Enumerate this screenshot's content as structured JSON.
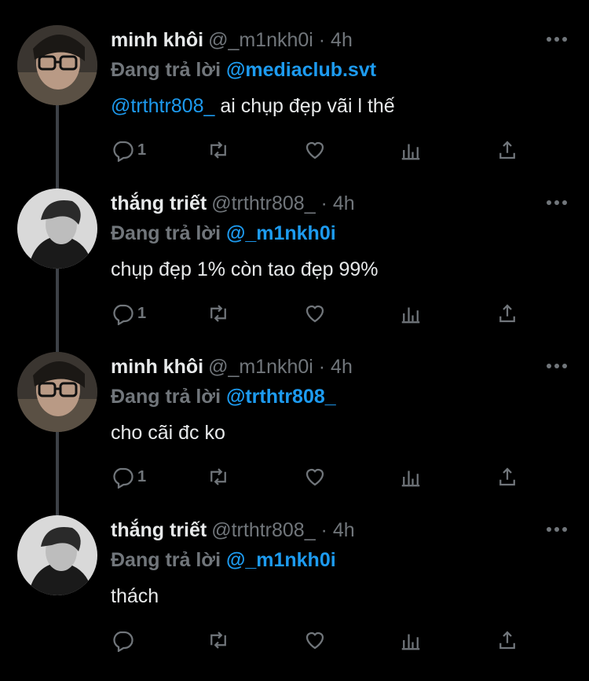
{
  "tweets": [
    {
      "name": "minh khôi",
      "handle": "@_m1nkh0i · 4h",
      "reply_prefix": "Đang trả lời",
      "reply_to": "@mediaclub.svt",
      "mention": "@trthtr808_",
      "text": " ai chụp đẹp vãi l thế",
      "reply_count": "1"
    },
    {
      "name": "thắng triết",
      "handle": "@trthtr808_ · 4h",
      "reply_prefix": "Đang trả lời",
      "reply_to": "@_m1nkh0i",
      "mention": "",
      "text": "chụp đẹp 1% còn tao đẹp 99%",
      "reply_count": "1"
    },
    {
      "name": "minh khôi",
      "handle": "@_m1nkh0i · 4h",
      "reply_prefix": "Đang trả lời",
      "reply_to": "@trthtr808_",
      "mention": "",
      "text": "cho cãi đc ko",
      "reply_count": "1"
    },
    {
      "name": "thắng triết",
      "handle": "@trthtr808_ · 4h",
      "reply_prefix": "Đang trả lời",
      "reply_to": "@_m1nkh0i",
      "mention": "",
      "text": "thách",
      "reply_count": ""
    }
  ],
  "colors": {
    "background": "#000000",
    "text": "#e7e9ea",
    "muted": "#71767b",
    "accent": "#1d9bf0",
    "thread_line": "#3d4147"
  },
  "icons": [
    "reply-icon",
    "retweet-icon",
    "like-icon",
    "analytics-icon",
    "share-icon",
    "more-icon"
  ]
}
